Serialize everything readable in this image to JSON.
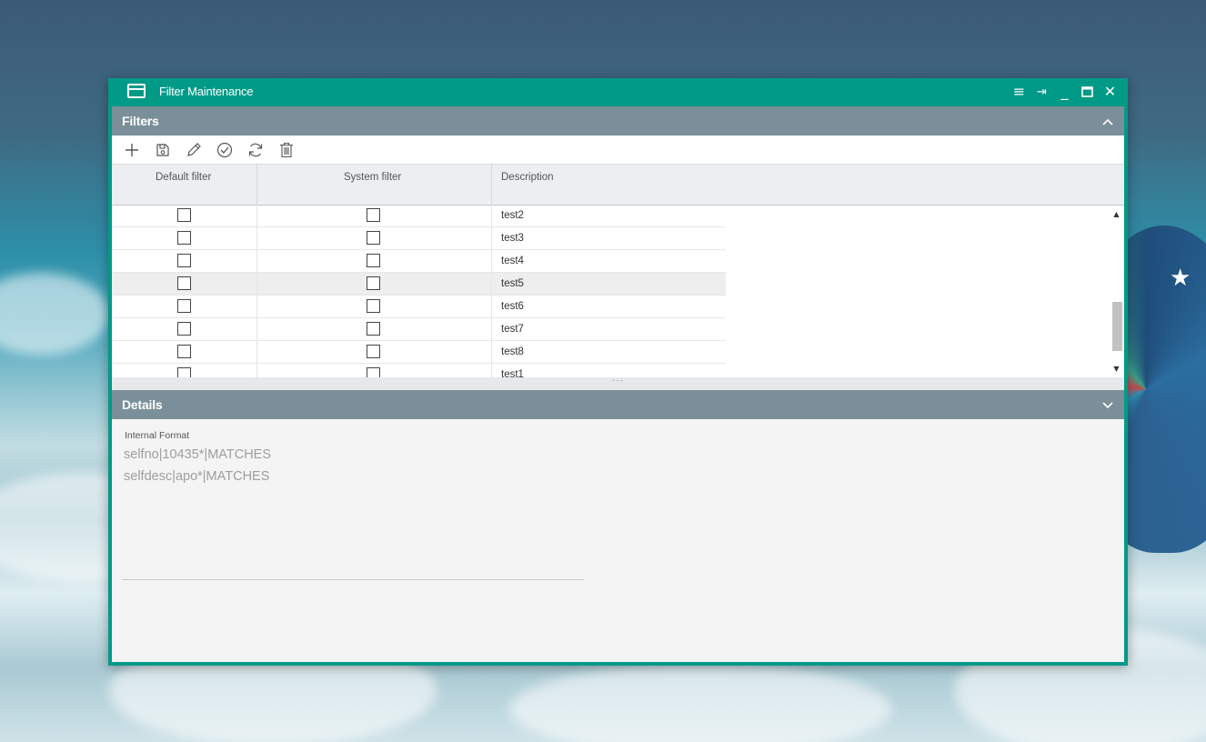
{
  "window": {
    "title": "Filter Maintenance",
    "controls": {
      "menu": "≡",
      "pin": "⇥",
      "minimize": "_",
      "maximize": "□",
      "close": "✕"
    }
  },
  "filters_section": {
    "title": "Filters",
    "collapse_icon": "chevron-up-icon",
    "toolbar": [
      "add-icon",
      "save-icon",
      "edit-icon",
      "check-circle-icon",
      "refresh-icon",
      "trash-icon"
    ],
    "columns": [
      "Default filter",
      "System filter",
      "Description"
    ],
    "rows": [
      {
        "default_filter": false,
        "system_filter": false,
        "description": "test2"
      },
      {
        "default_filter": false,
        "system_filter": false,
        "description": "test3"
      },
      {
        "default_filter": false,
        "system_filter": false,
        "description": "test4"
      },
      {
        "default_filter": false,
        "system_filter": false,
        "description": "test5",
        "selected": true
      },
      {
        "default_filter": false,
        "system_filter": false,
        "description": "test6"
      },
      {
        "default_filter": false,
        "system_filter": false,
        "description": "test7"
      },
      {
        "default_filter": false,
        "system_filter": false,
        "description": "test8"
      },
      {
        "default_filter": false,
        "system_filter": false,
        "description": "test1"
      }
    ],
    "splitter_label": "···"
  },
  "details_section": {
    "title": "Details",
    "expand_icon": "chevron-down-icon",
    "field_label": "Internal Format",
    "lines": [
      "selfno|10435*|MATCHES",
      "selfdesc|apo*|MATCHES"
    ]
  },
  "colors": {
    "accent": "#009a87",
    "section_header": "#7a8f99"
  }
}
